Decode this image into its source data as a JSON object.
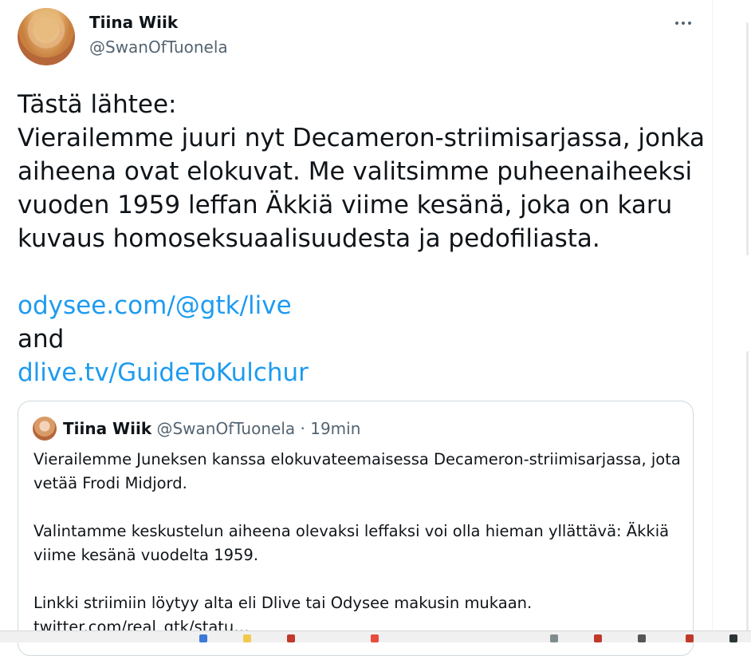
{
  "author": {
    "display_name": "Tiina Wiik",
    "handle": "@SwanOfTuonela"
  },
  "tweet": {
    "lines": [
      "Tästä lähtee:",
      "Vierailemme juuri nyt Decameron-striimisarjassa, jonka",
      "aiheena ovat elokuvat. Me valitsimme puheenaiheeksi",
      "vuoden 1959 leffan Äkkiä viime kesänä, joka on karu",
      "kuvaus homoseksuaalisuudesta ja pedofiliasta."
    ],
    "link1": "odysee.com/@gtk/live",
    "connector": "and",
    "link2": "dlive.tv/GuideToKulchur"
  },
  "quoted_tweet": {
    "display_name": "Tiina Wiik",
    "handle": "@SwanOfTuonela",
    "separator": "·",
    "time": "19min",
    "lines": [
      "Vierailemme Juneksen kanssa elokuvateemaisessa Decameron-striimisarjassa, jota",
      "vetää Frodi Midjord.",
      "",
      "Valintamme keskustelun aiheena olevaksi leffaksi voi olla hieman yllättävä: Äkkiä",
      "viime kesänä vuodelta 1959.",
      "",
      "Linkki striimiin löytyy alta eli Dlive tai Odysee makusin mukaan.",
      "twitter.com/real_gtk/statu…"
    ]
  },
  "icons": {
    "more": "more-horizontal-icon"
  },
  "colors": {
    "link": "#1d9bf0",
    "secondary_text": "#536471",
    "border": "#cfd9de"
  }
}
